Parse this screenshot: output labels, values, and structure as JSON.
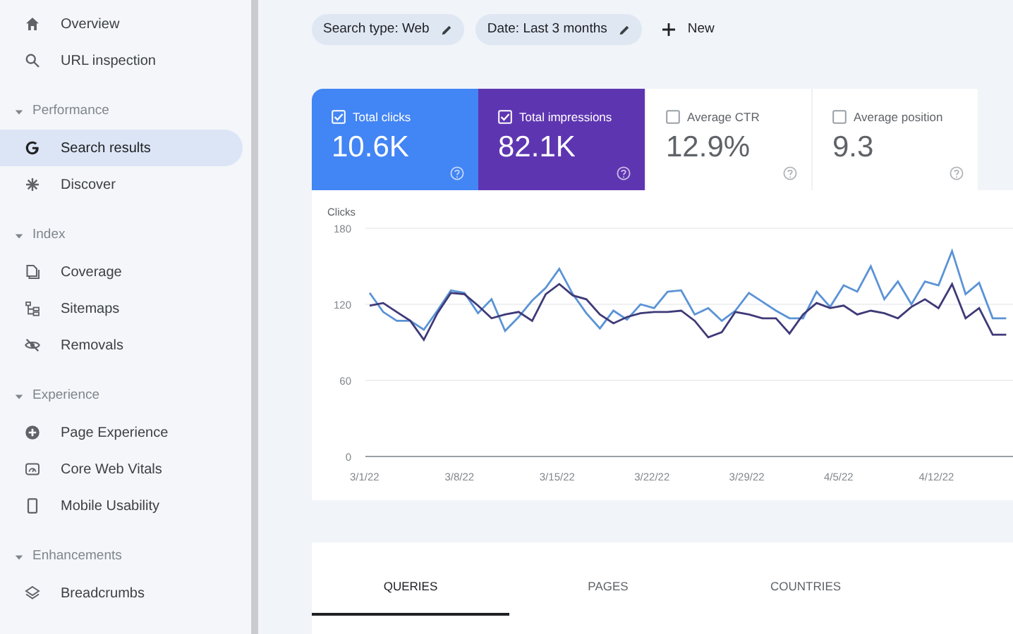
{
  "sidebar": {
    "items": [
      {
        "label": "Overview",
        "selected": false
      },
      {
        "label": "URL inspection",
        "selected": false
      }
    ],
    "sections": [
      {
        "title": "Performance",
        "expanded": true,
        "items": [
          {
            "label": "Search results",
            "selected": true
          },
          {
            "label": "Discover",
            "selected": false
          }
        ]
      },
      {
        "title": "Index",
        "expanded": true,
        "items": [
          {
            "label": "Coverage",
            "selected": false
          },
          {
            "label": "Sitemaps",
            "selected": false
          },
          {
            "label": "Removals",
            "selected": false
          }
        ]
      },
      {
        "title": "Experience",
        "expanded": true,
        "items": [
          {
            "label": "Page Experience",
            "selected": false
          },
          {
            "label": "Core Web Vitals",
            "selected": false
          },
          {
            "label": "Mobile Usability",
            "selected": false
          }
        ]
      },
      {
        "title": "Enhancements",
        "expanded": true,
        "items": [
          {
            "label": "Breadcrumbs",
            "selected": false
          }
        ]
      }
    ]
  },
  "filters": {
    "chips": [
      "Search type: Web",
      "Date: Last 3 months"
    ],
    "new_button": "New"
  },
  "metrics": [
    {
      "label": "Total clicks",
      "value": "10.6K",
      "checked": true,
      "color": "#4285f4"
    },
    {
      "label": "Total impressions",
      "value": "82.1K",
      "checked": true,
      "color": "#5e35b1"
    },
    {
      "label": "Average CTR",
      "value": "12.9%",
      "checked": false
    },
    {
      "label": "Average position",
      "value": "9.3",
      "checked": false
    }
  ],
  "chart": {
    "chart_data": {
      "type": "line",
      "ylabel": "Clicks",
      "ylim": [
        0,
        180
      ],
      "yticks": [
        0,
        60,
        120,
        180
      ],
      "categories": [
        "3/1/22",
        null,
        null,
        null,
        null,
        null,
        null,
        "3/8/22",
        null,
        null,
        null,
        null,
        null,
        null,
        "3/15/22",
        null,
        null,
        null,
        null,
        null,
        null,
        "3/22/22",
        null,
        null,
        null,
        null,
        null,
        null,
        "3/29/22",
        null,
        null,
        null,
        null,
        null,
        null,
        "4/5/22",
        null,
        null,
        null,
        null,
        null,
        null,
        "4/12/22",
        null,
        null,
        null,
        null,
        null
      ],
      "series": [
        {
          "color": "#5b93d6",
          "values": [
            129,
            114,
            107,
            107,
            100,
            115,
            131,
            129,
            113,
            124,
            99,
            110,
            123,
            133,
            148,
            128,
            113,
            101,
            115,
            108,
            120,
            117,
            130,
            131,
            112,
            117,
            107,
            115,
            129,
            122,
            115,
            109,
            109,
            130,
            118,
            135,
            130,
            150,
            124,
            138,
            120,
            138,
            135,
            162,
            128,
            137,
            109,
            109
          ]
        },
        {
          "color": "#3f3a78",
          "values": [
            119,
            121,
            114,
            107,
            92,
            113,
            129,
            128,
            119,
            109,
            112,
            114,
            107,
            128,
            136,
            127,
            124,
            112,
            105,
            110,
            113,
            114,
            114,
            115,
            107,
            94,
            98,
            114,
            112,
            109,
            109,
            97,
            112,
            121,
            117,
            119,
            112,
            115,
            113,
            109,
            118,
            124,
            117,
            136,
            109,
            117,
            96,
            96
          ]
        }
      ]
    }
  },
  "tabs": [
    {
      "label": "QUERIES",
      "selected": true
    },
    {
      "label": "PAGES",
      "selected": false
    },
    {
      "label": "COUNTRIES",
      "selected": false
    }
  ]
}
